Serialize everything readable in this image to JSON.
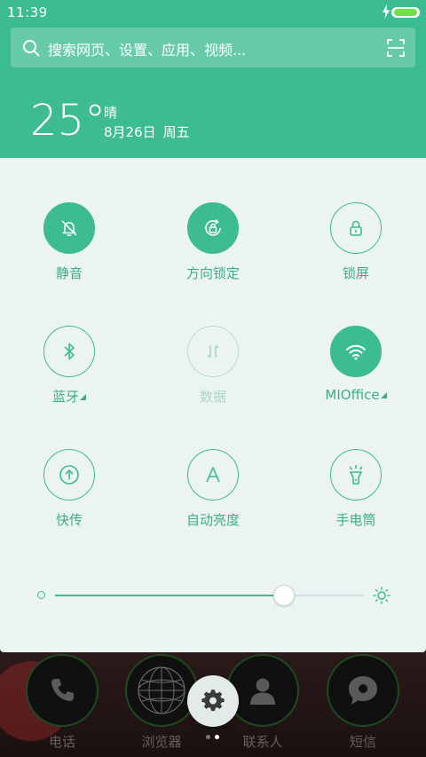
{
  "status": {
    "time": "11:39"
  },
  "search": {
    "placeholder": "搜索网页、设置、应用、视频..."
  },
  "weather": {
    "temperature": "25°",
    "condition": "晴",
    "date": "8月26日",
    "weekday": "周五"
  },
  "toggles": [
    {
      "id": "mute",
      "label": "静音",
      "icon": "bell-off-icon",
      "state": "on"
    },
    {
      "id": "rotation-lock",
      "label": "方向锁定",
      "icon": "rotation-lock-icon",
      "state": "on"
    },
    {
      "id": "lock-screen",
      "label": "锁屏",
      "icon": "lock-icon",
      "state": "off"
    },
    {
      "id": "bluetooth",
      "label": "蓝牙",
      "icon": "bluetooth-icon",
      "state": "off",
      "expandable": true
    },
    {
      "id": "data",
      "label": "数据",
      "icon": "data-arrows-icon",
      "state": "disabled"
    },
    {
      "id": "wifi",
      "label": "MIOffice",
      "icon": "wifi-icon",
      "state": "on",
      "expandable": true
    },
    {
      "id": "quick-transfer",
      "label": "快传",
      "icon": "upload-arrow-icon",
      "state": "off"
    },
    {
      "id": "auto-brightness",
      "label": "自动亮度",
      "icon": "letter-a-icon",
      "state": "off"
    },
    {
      "id": "flashlight",
      "label": "手电筒",
      "icon": "flashlight-icon",
      "state": "off"
    }
  ],
  "brightness": {
    "level": 0.74
  },
  "dock": [
    {
      "label": "电话",
      "icon": "phone-icon"
    },
    {
      "label": "浏览器",
      "icon": "browser-globe-icon"
    },
    {
      "label": "联系人",
      "icon": "contact-person-icon"
    },
    {
      "label": "短信",
      "icon": "message-bubble-icon"
    }
  ],
  "colors": {
    "accent": "#3dbb92",
    "panel": "#ebf3f3",
    "battery": "#6fe04a"
  }
}
